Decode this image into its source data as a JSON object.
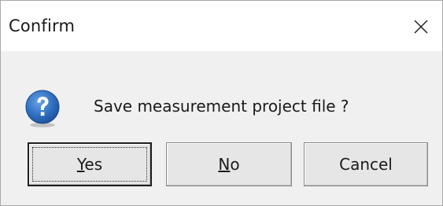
{
  "window": {
    "title": "Confirm",
    "close_glyph": "✕"
  },
  "message": {
    "icon": "question-icon",
    "text": "Save measurement project file ?"
  },
  "buttons": {
    "yes": {
      "mnemonic": "Y",
      "rest": "es"
    },
    "no": {
      "mnemonic": "N",
      "rest": "o"
    },
    "cancel": {
      "label": "Cancel"
    }
  },
  "colors": {
    "icon_blue": "#2f6fc0",
    "icon_blue_dark": "#1d4f98"
  }
}
